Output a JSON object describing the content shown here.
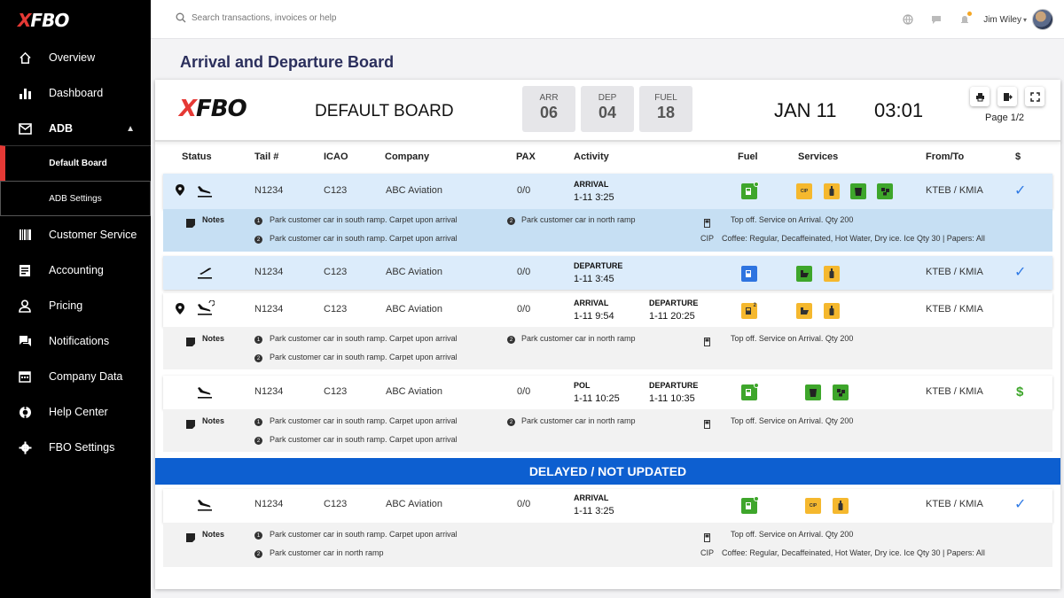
{
  "brand": {
    "logo_x": "X",
    "logo_rest": "FBO"
  },
  "sidebar": {
    "items": [
      {
        "label": "Overview"
      },
      {
        "label": "Dashboard"
      },
      {
        "label": "ADB"
      },
      {
        "label": "Customer Service"
      },
      {
        "label": "Accounting"
      },
      {
        "label": "Pricing"
      },
      {
        "label": "Notifications"
      },
      {
        "label": "Company Data"
      },
      {
        "label": "Help Center"
      },
      {
        "label": "FBO Settings"
      }
    ],
    "sub_items": [
      {
        "label": "Default Board"
      },
      {
        "label": "ADB Settings"
      }
    ]
  },
  "topbar": {
    "search_placeholder": "Search transactions, invoices or help",
    "user_name": "Jim Wiley"
  },
  "page_title": "Arrival and Departure Board",
  "board": {
    "name": "DEFAULT BOARD",
    "stats": [
      {
        "label": "ARR",
        "value": "06"
      },
      {
        "label": "DEP",
        "value": "04"
      },
      {
        "label": "FUEL",
        "value": "18"
      }
    ],
    "date": "JAN 11",
    "time": "03:01",
    "page": "Page 1/2"
  },
  "columns": {
    "status": "Status",
    "tail": "Tail #",
    "icao": "ICAO",
    "company": "Company",
    "pax": "PAX",
    "activity": "Activity",
    "fuel": "Fuel",
    "services": "Services",
    "from_to": "From/To",
    "price": "$"
  },
  "rows": [
    {
      "tail": "N1234",
      "icao": "C123",
      "company": "ABC Aviation",
      "pax": "0/0",
      "act1_label": "ARRIVAL",
      "act1_value": "1-11 3:25",
      "from_to": "KTEB / KMIA"
    },
    {
      "tail": "N1234",
      "icao": "C123",
      "company": "ABC Aviation",
      "pax": "0/0",
      "act1_label": "DEPARTURE",
      "act1_value": "1-11 3:45",
      "from_to": "KTEB / KMIA"
    },
    {
      "tail": "N1234",
      "icao": "C123",
      "company": "ABC Aviation",
      "pax": "0/0",
      "act1_label": "ARRIVAL",
      "act1_value": "1-11 9:54",
      "act2_label": "DEPARTURE",
      "act2_value": "1-11 20:25",
      "from_to": "KTEB / KMIA"
    },
    {
      "tail": "N1234",
      "icao": "C123",
      "company": "ABC Aviation",
      "pax": "0/0",
      "act1_label": "POL",
      "act1_value": "1-11 10:25",
      "act2_label": "DEPARTURE",
      "act2_value": "1-11 10:35",
      "from_to": "KTEB / KMIA",
      "price": "$"
    },
    {
      "tail": "N1234",
      "icao": "C123",
      "company": "ABC Aviation",
      "pax": "0/0",
      "act1_label": "ARRIVAL",
      "act1_value": "1-11 3:25",
      "from_to": "KTEB / KMIA"
    }
  ],
  "notes": {
    "label": "Notes",
    "note_south": "Park customer car in south ramp. Carpet upon arrival",
    "note_north": "Park customer car in north ramp",
    "fuel_note": "Top off. Service on Arrival. Qty 200",
    "cip_label": "CIP",
    "cip_note": "Coffee: Regular, Decaffeinated, Hot Water, Dry ice. Ice Qty 30 | Papers: All",
    "n1": "1",
    "n2": "2"
  },
  "service_labels": {
    "cip": "CIP",
    "fuel_count": "2"
  },
  "delayed_banner": "DELAYED / NOT UPDATED",
  "check_glyph": "✓",
  "colors": {
    "accent_blue": "#0d5fd0",
    "green": "#3ea62b",
    "yellow": "#f5b82e",
    "brand_red": "#e53935",
    "row_blue": "#dcecfb"
  }
}
